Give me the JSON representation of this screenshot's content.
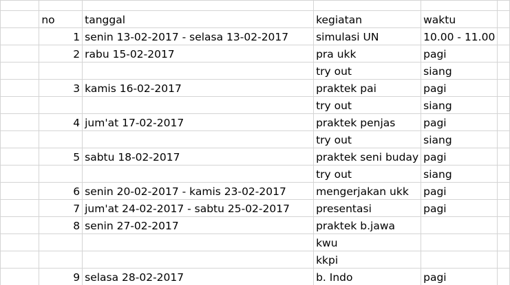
{
  "header": {
    "no": "no",
    "tanggal": "tanggal",
    "kegiatan": "kegiatan",
    "waktu": "waktu"
  },
  "rows": [
    {
      "no": "1",
      "tanggal": "senin 13-02-2017 - selasa 13-02-2017",
      "kegiatan": "simulasi UN",
      "waktu": "10.00 - 11.00"
    },
    {
      "no": "2",
      "tanggal": "rabu 15-02-2017",
      "kegiatan": "pra ukk",
      "waktu": "pagi"
    },
    {
      "no": "",
      "tanggal": "",
      "kegiatan": "try out",
      "waktu": "siang"
    },
    {
      "no": "3",
      "tanggal": "kamis 16-02-2017",
      "kegiatan": "praktek pai",
      "waktu": "pagi"
    },
    {
      "no": "",
      "tanggal": "",
      "kegiatan": "try out",
      "waktu": "siang"
    },
    {
      "no": "4",
      "tanggal": "jum'at 17-02-2017",
      "kegiatan": "praktek penjas",
      "waktu": "pagi"
    },
    {
      "no": "",
      "tanggal": "",
      "kegiatan": "try out",
      "waktu": "siang"
    },
    {
      "no": "5",
      "tanggal": "sabtu 18-02-2017",
      "kegiatan": "praktek seni buday",
      "waktu": "pagi"
    },
    {
      "no": "",
      "tanggal": "",
      "kegiatan": "try out",
      "waktu": "siang"
    },
    {
      "no": "6",
      "tanggal": "senin 20-02-2017 - kamis 23-02-2017",
      "kegiatan": "mengerjakan ukk",
      "waktu": "pagi"
    },
    {
      "no": "7",
      "tanggal": "jum'at 24-02-2017 - sabtu 25-02-2017",
      "kegiatan": "presentasi",
      "waktu": "pagi"
    },
    {
      "no": "8",
      "tanggal": "senin 27-02-2017",
      "kegiatan": "praktek b.jawa",
      "waktu": ""
    },
    {
      "no": "",
      "tanggal": "",
      "kegiatan": "kwu",
      "waktu": ""
    },
    {
      "no": "",
      "tanggal": "",
      "kegiatan": "kkpi",
      "waktu": ""
    },
    {
      "no": "9",
      "tanggal": "selasa 28-02-2017",
      "kegiatan": "b. Indo",
      "waktu": "pagi"
    }
  ]
}
